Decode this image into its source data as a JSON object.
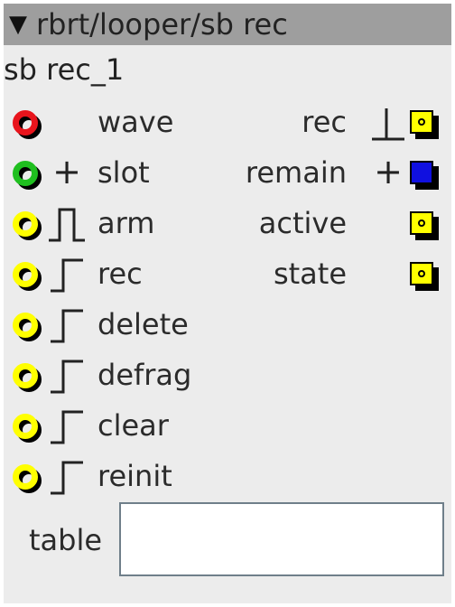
{
  "window": {
    "collapse_glyph": "▼",
    "title": "rbrt/looper/sb rec"
  },
  "node_name": "sb rec_1",
  "colors": {
    "titlebar": "#9e9e9e",
    "panel": "#ececec",
    "inlet_red": "#e8141c",
    "inlet_green": "#1fbf1f",
    "inlet_yellow": "#ffff00",
    "outlet_yellow": "#ffff00",
    "outlet_blue": "#1010e0"
  },
  "inlets": [
    {
      "label": "wave",
      "color": "red",
      "type_icon": "none"
    },
    {
      "label": "slot",
      "color": "green",
      "type_icon": "plus-icon",
      "type_glyph": "+"
    },
    {
      "label": "arm",
      "color": "yellow",
      "type_icon": "pulse-icon"
    },
    {
      "label": "rec",
      "color": "yellow",
      "type_icon": "rising-edge-icon"
    },
    {
      "label": "delete",
      "color": "yellow",
      "type_icon": "rising-edge-icon"
    },
    {
      "label": "defrag",
      "color": "yellow",
      "type_icon": "rising-edge-icon"
    },
    {
      "label": "clear",
      "color": "yellow",
      "type_icon": "rising-edge-icon"
    },
    {
      "label": "reinit",
      "color": "yellow",
      "type_icon": "rising-edge-icon"
    }
  ],
  "outlets": [
    {
      "label": "rec",
      "color": "yellow",
      "type_icon": "falling-step-icon"
    },
    {
      "label": "remain",
      "color": "blue",
      "type_icon": "plus-icon",
      "type_glyph": "+"
    },
    {
      "label": "active",
      "color": "yellow",
      "type_icon": "none"
    },
    {
      "label": "state",
      "color": "yellow",
      "type_icon": "none"
    }
  ],
  "attribute": {
    "label": "table",
    "value": ""
  }
}
